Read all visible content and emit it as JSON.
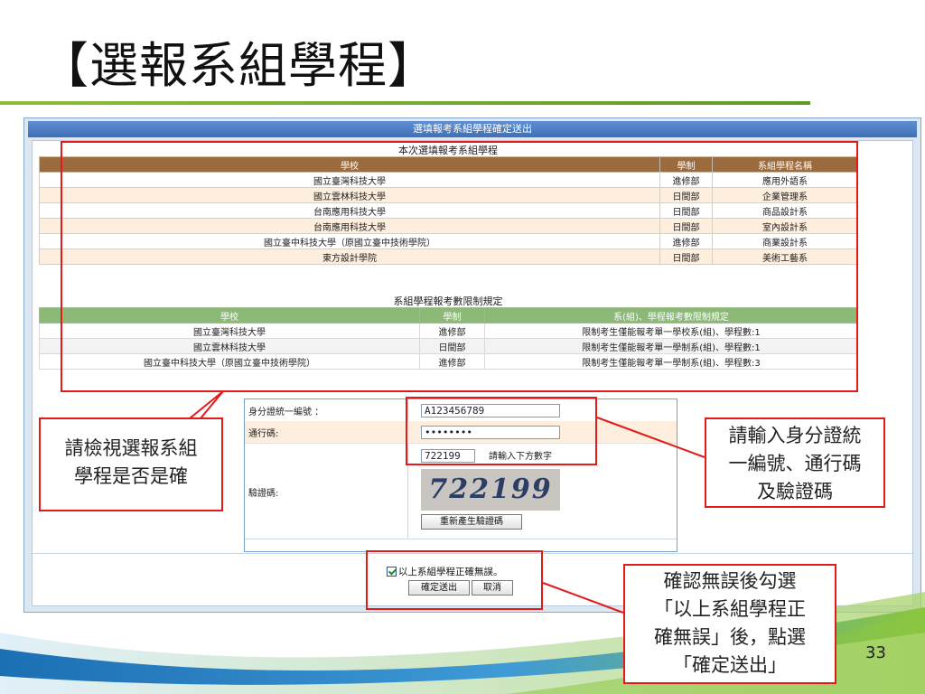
{
  "slide": {
    "title": "【選報系組學程】",
    "page_number": "33"
  },
  "dialog": {
    "title": "選填報考系組學程確定送出"
  },
  "table1": {
    "caption": "本次選填報考系組學程",
    "headers": [
      "學校",
      "學制",
      "系組學程名稱"
    ],
    "rows": [
      [
        "國立臺灣科技大學",
        "進修部",
        "應用外語系"
      ],
      [
        "國立雲林科技大學",
        "日間部",
        "企業管理系"
      ],
      [
        "台南應用科技大學",
        "日間部",
        "商品設計系"
      ],
      [
        "台南應用科技大學",
        "日間部",
        "室內設計系"
      ],
      [
        "國立臺中科技大學（原國立臺中技術學院）",
        "進修部",
        "商業設計系"
      ],
      [
        "東方設計學院",
        "日間部",
        "美術工藝系"
      ]
    ]
  },
  "table2": {
    "caption": "系組學程報考數限制規定",
    "headers": [
      "學校",
      "學制",
      "系(組)、學程報考數限制規定"
    ],
    "rows": [
      [
        "國立臺灣科技大學",
        "進修部",
        "限制考生僅能報考單一學校系(組)、學程數:1"
      ],
      [
        "國立雲林科技大學",
        "日間部",
        "限制考生僅能報考單一學制系(組)、學程數:1"
      ],
      [
        "國立臺中科技大學（原國立臺中技術學院）",
        "進修部",
        "限制考生僅能報考單一學制系(組)、學程數:3"
      ]
    ]
  },
  "form": {
    "id_label": "身分證統一編號 ：",
    "id_value": "A123456789",
    "password_label": "通行碼:",
    "password_value": "••••••••",
    "captcha_label": "驗證碼:",
    "captcha_input_value": "722199",
    "captcha_hint": "請輸入下方數字",
    "captcha_image_text": "722199",
    "regenerate_button": "重新產生驗證碼"
  },
  "confirm": {
    "checkbox_label": "以上系組學程正確無誤。",
    "checked": true,
    "submit_button": "確定送出",
    "cancel_button": "取消"
  },
  "callouts": {
    "review": [
      "請檢視選報系組",
      "學程是否是確"
    ],
    "credentials": [
      "請輸入身分證統",
      "一編號、通行碼",
      "及驗證碼"
    ],
    "confirm": [
      "確認無誤後勾選",
      "「以上系組學程正",
      "確無誤」後，點選",
      "「確定送出」"
    ]
  },
  "colors": {
    "accent_red": "#e31a1a",
    "table1_header": "#9b6b3e",
    "table2_header": "#8cb878",
    "title_rule": "#7aae32"
  }
}
